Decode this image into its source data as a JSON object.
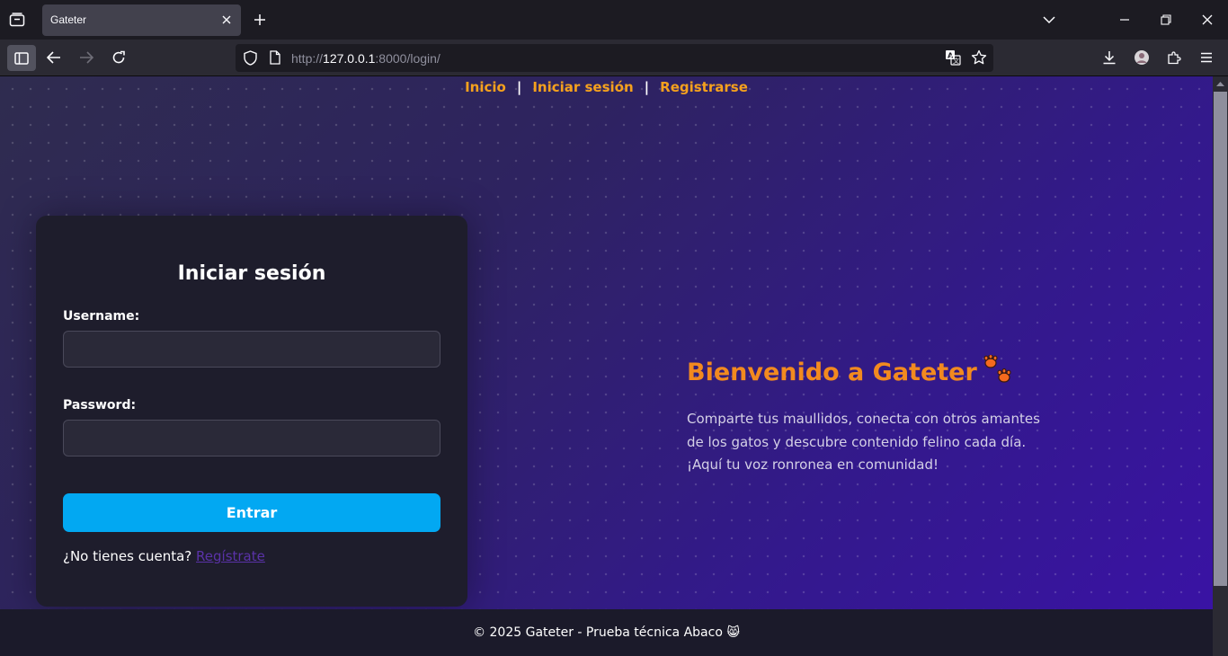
{
  "browser": {
    "tab_title": "Gateter",
    "url_prefix": "http://",
    "url_host": "127.0.0.1",
    "url_rest": ":8000/login/"
  },
  "nav": {
    "links": [
      "Inicio",
      "Iniciar sesión",
      "Registrarse"
    ],
    "separator": "|"
  },
  "login": {
    "title": "Iniciar sesión",
    "username_label": "Username:",
    "username_value": "",
    "password_label": "Password:",
    "password_value": "",
    "submit_label": "Entrar",
    "no_account_text": "¿No tienes cuenta?",
    "register_link": "Regístrate"
  },
  "hero": {
    "title": "Bienvenido a Gateter",
    "text": "Comparte tus maullidos, conecta con otros amantes de los gatos y descubre contenido felino cada día. ¡Aquí tu voz ronronea en comunidad!"
  },
  "footer": {
    "text": "© 2025 Gateter - Prueba técnica Abaco 😸"
  },
  "colors": {
    "accent_orange": "#f28a1f",
    "button_blue": "#02a8f2",
    "card_bg": "#1e1d2c"
  },
  "icons": [
    "tab-list-icon",
    "close-icon",
    "plus-icon",
    "chevron-down-icon",
    "minimize-icon",
    "restore-icon",
    "sidebar-icon",
    "back-arrow-icon",
    "forward-arrow-icon",
    "reload-icon",
    "shield-icon",
    "page-icon",
    "translate-icon",
    "star-icon",
    "download-icon",
    "account-icon",
    "extensions-icon",
    "menu-icon",
    "paw-icon"
  ]
}
